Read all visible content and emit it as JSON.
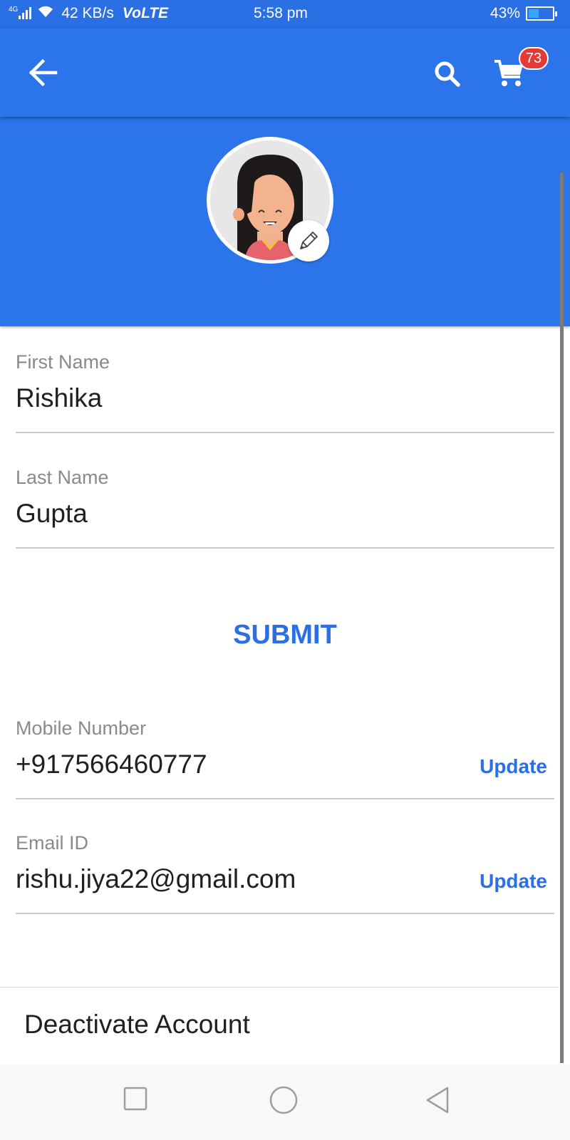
{
  "status_bar": {
    "network": "4G",
    "speed": "42 KB/s",
    "volte": "VoLTE",
    "time": "5:58 pm",
    "battery_percent": "43%",
    "battery_level": 0.43
  },
  "app_bar": {
    "back_icon": "arrow-left-icon",
    "search_icon": "search-icon",
    "cart_icon": "cart-icon",
    "cart_count": "73"
  },
  "profile": {
    "avatar_icon": "avatar-illustration",
    "edit_icon": "pencil-icon"
  },
  "form": {
    "first_name": {
      "label": "First Name",
      "value": "Rishika"
    },
    "last_name": {
      "label": "Last Name",
      "value": "Gupta"
    },
    "submit_label": "SUBMIT",
    "mobile": {
      "label": "Mobile Number",
      "value": "+917566460777",
      "action": "Update"
    },
    "email": {
      "label": "Email ID",
      "value": "rishu.jiya22@gmail.com",
      "action": "Update"
    }
  },
  "deactivate_label": "Deactivate Account",
  "colors": {
    "primary": "#2b74ea",
    "accent_text": "#2a6fe4",
    "badge": "#e53935"
  }
}
